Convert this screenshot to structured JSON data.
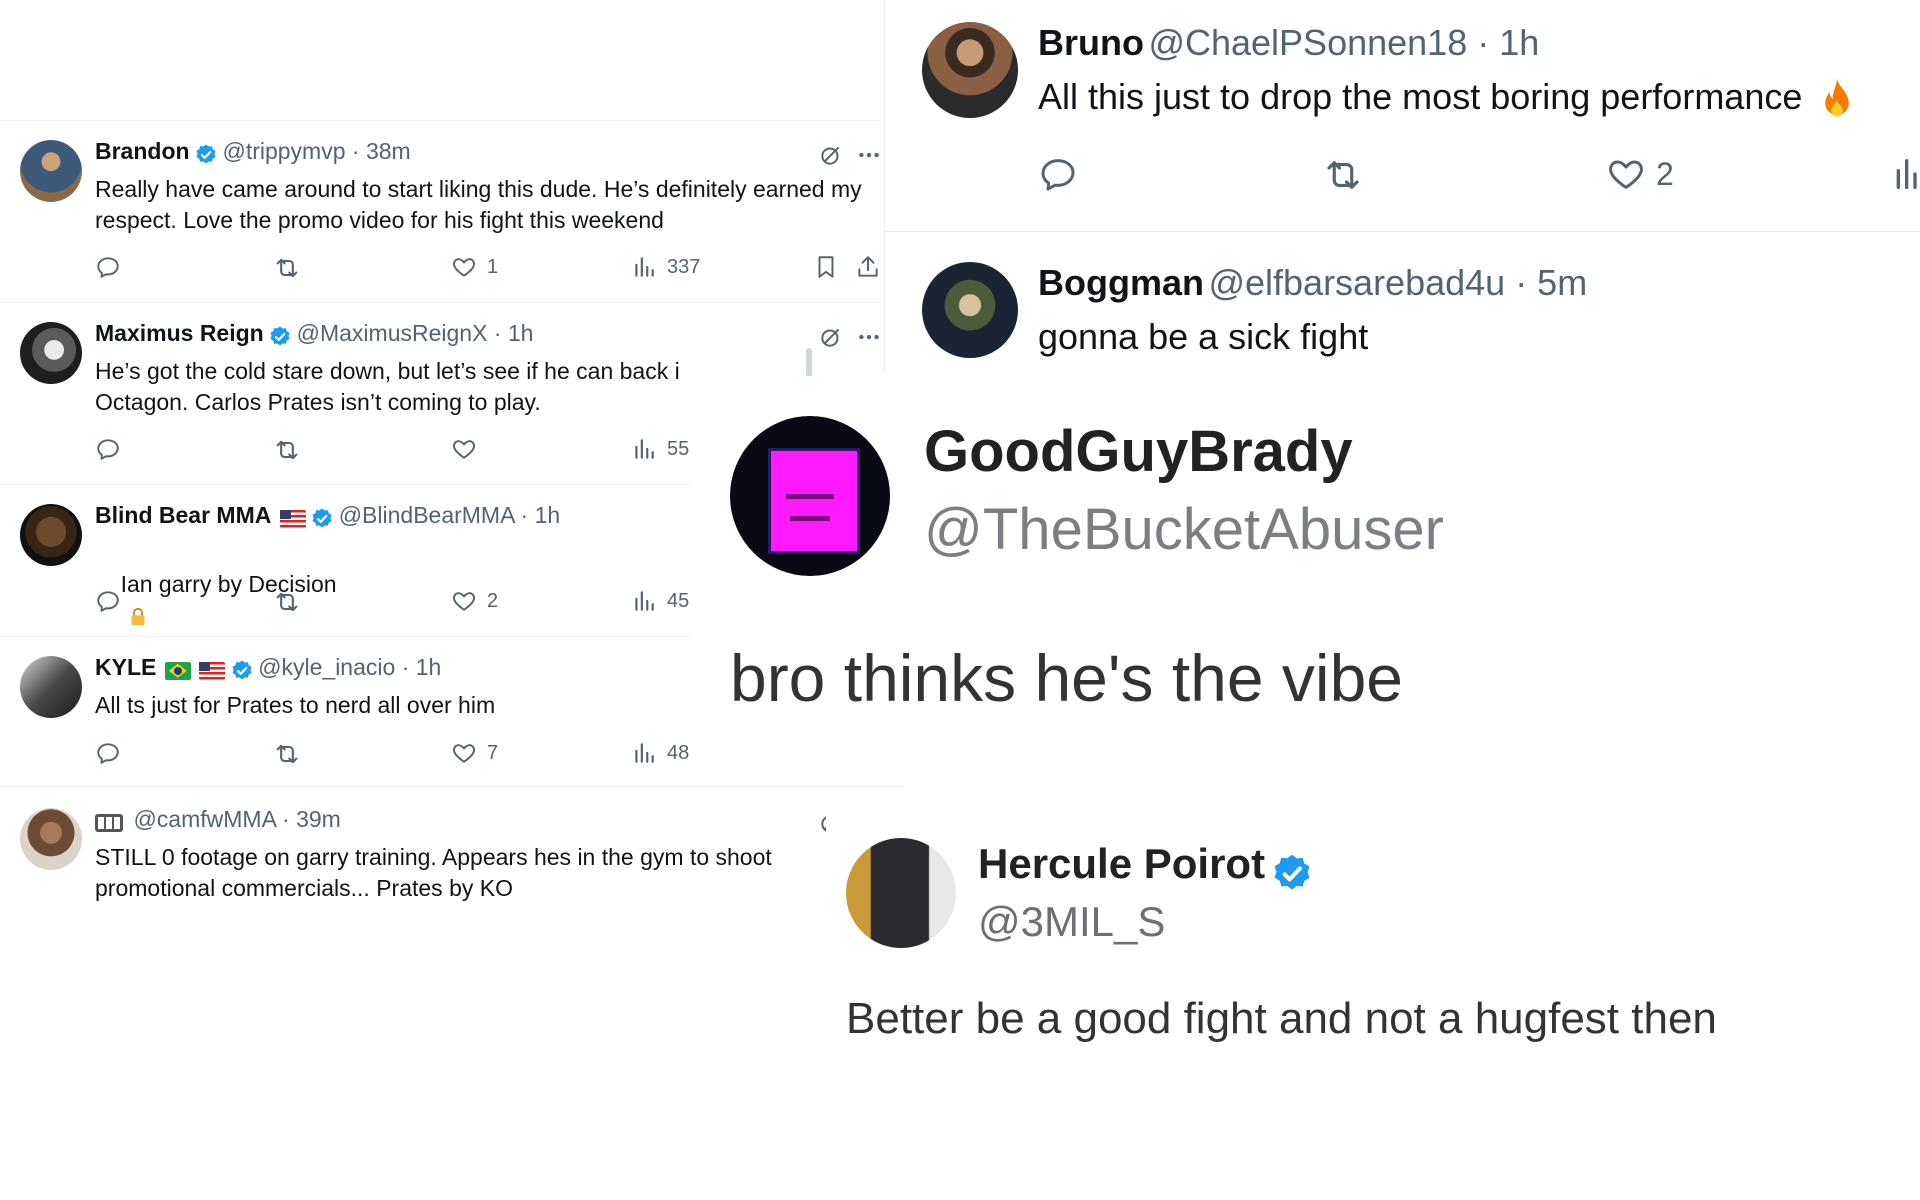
{
  "left_tweets": [
    {
      "name": "Brandon",
      "verified": true,
      "handle": "@trippymvp · 38m",
      "text": "Really have came around to start liking this dude. He’s definitely earned my\nrespect. Love the promo video for his fight this weekend",
      "reply": "",
      "retweet": "",
      "like": "1",
      "views": "337"
    },
    {
      "name": "Maximus Reign",
      "verified": true,
      "handle": "@MaximusReignX · 1h",
      "text": "He’s got the cold stare down, but let’s see if he can back i\nOctagon. Carlos Prates isn’t coming to play.",
      "like": "",
      "views": "55"
    },
    {
      "name": "Blind Bear MMA",
      "verified": true,
      "handle": "@BlindBearMMA · 1h",
      "text": "Ian garry by Decision",
      "like": "2",
      "views": "45"
    },
    {
      "name": "KYLE",
      "verified": true,
      "handle": "@kyle_inacio · 1h",
      "text": "All ts just for Prates to nerd all over him",
      "like": "7",
      "views": "48"
    },
    {
      "name": "",
      "verified": false,
      "handle": "@camfwMMA · 39m",
      "text": "STILL 0 footage on garry training. Appears hes in the gym to shoot\npromotional commercials... Prates by KO"
    }
  ],
  "right_tweets": [
    {
      "name": "Bruno",
      "handle": "@ChaelPSonnen18 · 1h",
      "text": "All this just to drop the most boring performance",
      "like": "2"
    },
    {
      "name": "Boggman",
      "handle": "@elfbarsarebad4u · 5m",
      "text": "gonna be a sick fight"
    }
  ],
  "big_tweet": {
    "name": "GoodGuyBrady",
    "handle": "@TheBucketAbuser",
    "text": "bro thinks he's the vibe"
  },
  "hp_tweet": {
    "name": "Hercule Poirot",
    "handle": "@3MIL_S",
    "text": "Better be a good fight and not a hugfest then"
  },
  "colors": {
    "verified": "#1d9bf0",
    "muted": "#536471",
    "text": "#0f1419",
    "lock": "#f4b942",
    "fire": "#f57c00",
    "avatar_magenta": "#ff19ff"
  },
  "icons": [
    "reply-icon",
    "retweet-icon",
    "like-icon",
    "views-icon",
    "bookmark-icon",
    "share-icon",
    "grok-icon",
    "more-icon",
    "verified-icon",
    "lock-icon",
    "fire-icon"
  ]
}
